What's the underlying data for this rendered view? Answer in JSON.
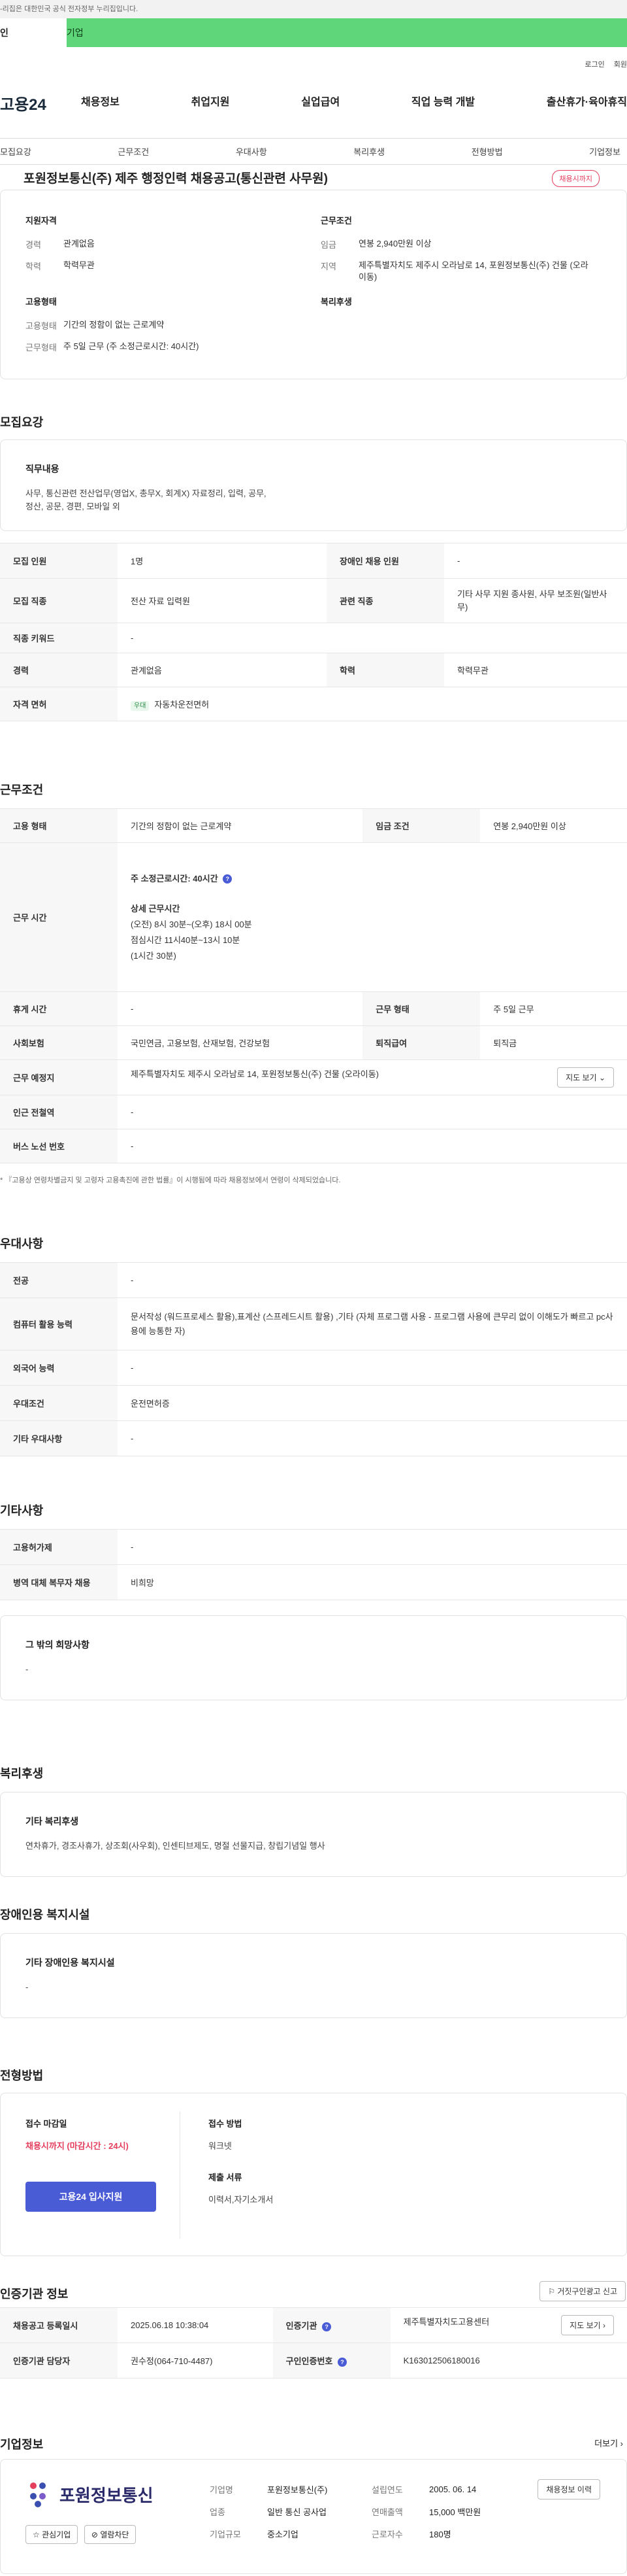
{
  "top_notice": "-리집은 대한민국 공식 전자정부 누리집입니다.",
  "tabs": [
    "인",
    "기업"
  ],
  "header": {
    "util": [
      "로그인",
      "회원"
    ],
    "logo": "고용24",
    "nav": [
      "채용정보",
      "취업지원",
      "실업급여",
      "직업 능력 개발",
      "출산휴가·육아휴직"
    ]
  },
  "subnav": [
    "모집요강",
    "근무조건",
    "우대사항",
    "복리후생",
    "전형방법",
    "기업정보"
  ],
  "title": "포원정보통신(주) 제주 행정인력 채용공고(통신관련 사무원)",
  "badge": "채용시까지",
  "summary": {
    "qual_title": "지원자격",
    "qual": [
      {
        "k": "경력",
        "v": "관계없음"
      },
      {
        "k": "학력",
        "v": "학력무관"
      }
    ],
    "cond_title": "근무조건",
    "cond": [
      {
        "k": "임금",
        "v": "연봉 2,940만원 이상"
      },
      {
        "k": "지역",
        "v": "제주특별자치도 제주시 오라남로 14, 포원정보통신(주) 건물 (오라이동)"
      }
    ],
    "emp_title": "고용형태",
    "emp": [
      {
        "k": "고용형태",
        "v": "기간의 정함이 없는 근로계약"
      },
      {
        "k": "근무형태",
        "v": "주 5일 근무 (주 소정근로시간: 40시간)"
      }
    ],
    "welfare_title": "복리후생"
  },
  "recruit": {
    "title": "모집요강",
    "duty_title": "직무내용",
    "duty": "사무, 통신관련 전산업무(영업X, 총무X, 회계X) 자료정리, 입력, 공무, 정산, 공문, 경편, 모바일 외",
    "rows": [
      [
        "모집 인원",
        "1명",
        "장애인 채용 인원",
        "-"
      ],
      [
        "모집 직종",
        "전산 자료 입력원",
        "관련 직종",
        "기타 사무 지원 종사원, 사무 보조원(일반사무)"
      ],
      [
        "직종 키워드",
        "-",
        "",
        ""
      ],
      [
        "경력",
        "관계없음",
        "학력",
        "학력무관"
      ],
      [
        "자격 면허",
        "자동차운전면허",
        "",
        ""
      ]
    ],
    "license_tag": "우대"
  },
  "work": {
    "title": "근무조건",
    "rows": [
      [
        "고용 형태",
        "기간의 정함이 없는 근로계약",
        "임금 조건",
        "연봉 2,940만원 이상"
      ],
      [
        "휴게 시간",
        "-",
        "근무 형태",
        "주 5일 근무"
      ],
      [
        "사회보험",
        "국민연금, 고용보험, 산재보험, 건강보험",
        "퇴직급여",
        "퇴직금"
      ],
      [
        "근무 예정지",
        "제주특별자치도 제주시 오라남로 14, 포원정보통신(주) 건물 (오라이동)",
        "",
        ""
      ],
      [
        "인근 전철역",
        "-",
        "",
        ""
      ],
      [
        "버스 노선 번호",
        "-",
        "",
        ""
      ]
    ],
    "hours_label": "근무 시간",
    "hours": [
      "주 소정근로시간: 40시간",
      "상세 근무시간",
      "(오전) 8시 30분~(오후) 18시 00분",
      "점심시간 11시40분~13시 10분",
      "(1시간 30분)"
    ],
    "map_btn": "지도 보기",
    "note": "* 『고용상 연령차별금지 및 고령자 고용촉진에 관한 법률』이 시행됨에 따라 채용정보에서 연령이 삭제되었습니다."
  },
  "pref": {
    "title": "우대사항",
    "rows": [
      [
        "전공",
        "-"
      ],
      [
        "컴퓨터 활용 능력",
        "문서작성 (워드프로세스 활용),표계산 (스프레드시트 활용) ,기타 (자체 프로그램 사용 - 프로그램 사용에 큰무리 없이 이해도가 빠르고 pc사용에 능통한 자)"
      ],
      [
        "외국어 능력",
        "-"
      ],
      [
        "우대조건",
        "운전면허증"
      ],
      [
        "기타 우대사항",
        "-"
      ]
    ]
  },
  "etc": {
    "title": "기타사항",
    "rows": [
      [
        "고용허가제",
        "-"
      ],
      [
        "병역 대체 복무자 채용",
        "비희망"
      ]
    ],
    "hope_title": "그 밖의 희망사항",
    "hope": "-"
  },
  "welfare": {
    "title": "복리후생",
    "sub": "기타 복리후생",
    "text": "연차휴가, 경조사휴가, 상조회(사우회), 인센티브제도, 명절 선물지급, 창립기념일 행사"
  },
  "disabled": {
    "title": "장애인용 복지시설",
    "sub": "기타 장애인용 복지시설",
    "text": "-"
  },
  "process": {
    "title": "전형방법",
    "deadline_label": "접수 마감일",
    "deadline": "채용시까지 (마감시간 : 24시)",
    "cta": "고용24 입사지원",
    "method_label": "접수 방법",
    "method": "워크넷",
    "docs_label": "제출 서류",
    "docs": "이력서,자기소개서"
  },
  "cert": {
    "title": "인증기관 정보",
    "report_btn": "거짓구인광고 신고",
    "rows": [
      [
        "채용공고 등록일시",
        "2025.06.18 10:38:04",
        "인증기관",
        "제주특별자치도고용센터"
      ],
      [
        "인증기관 담당자",
        "권수정(064-710-4487)",
        "구인인증번호",
        "K163012506180016"
      ]
    ],
    "map_btn": "지도 보기"
  },
  "company": {
    "title": "기업정보",
    "more": "더보기",
    "logo_text": "포원정보통신",
    "fav": "관심기업",
    "block": "열람차단",
    "rows": [
      [
        "기업명",
        "포원정보통신(주)",
        "설립연도",
        "2005. 06. 14"
      ],
      [
        "업종",
        "일반 통신 공사업",
        "연매출액",
        "15,000 백만원"
      ],
      [
        "기업규모",
        "중소기업",
        "근로자수",
        "180명"
      ]
    ],
    "history_btn": "채용정보 이력"
  }
}
